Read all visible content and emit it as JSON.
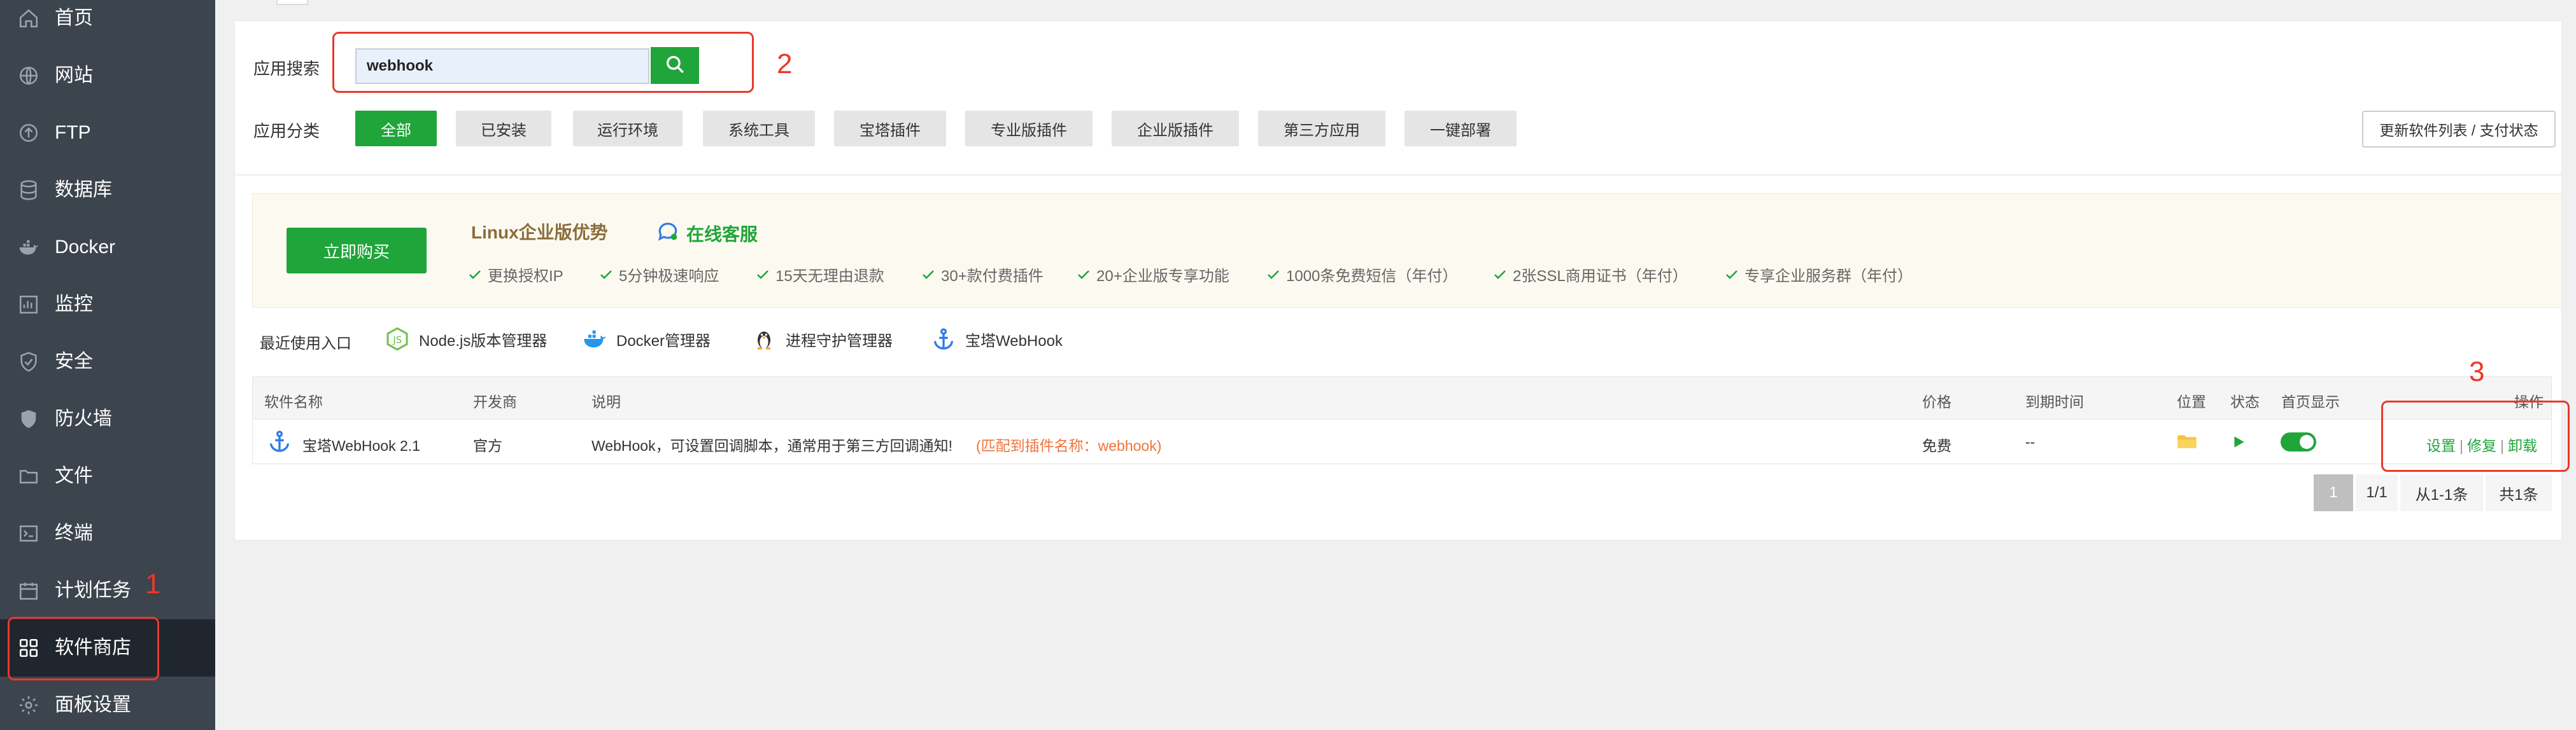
{
  "sidebar": {
    "items": [
      {
        "label": "首页",
        "icon": "home-icon"
      },
      {
        "label": "网站",
        "icon": "globe-icon"
      },
      {
        "label": "FTP",
        "icon": "ftp-icon"
      },
      {
        "label": "数据库",
        "icon": "database-icon"
      },
      {
        "label": "Docker",
        "icon": "docker-icon"
      },
      {
        "label": "监控",
        "icon": "monitor-icon"
      },
      {
        "label": "安全",
        "icon": "shield-icon"
      },
      {
        "label": "防火墙",
        "icon": "firewall-icon"
      },
      {
        "label": "文件",
        "icon": "folder-icon"
      },
      {
        "label": "终端",
        "icon": "terminal-icon"
      },
      {
        "label": "计划任务",
        "icon": "calendar-icon"
      },
      {
        "label": "软件商店",
        "icon": "apps-grid-icon",
        "active": true
      },
      {
        "label": "面板设置",
        "icon": "gear-icon"
      }
    ]
  },
  "search": {
    "label": "应用搜索",
    "value": "webhook"
  },
  "categories": {
    "label": "应用分类",
    "items": [
      "全部",
      "已安装",
      "运行环境",
      "系统工具",
      "宝塔插件",
      "专业版插件",
      "企业版插件",
      "第三方应用",
      "一键部署"
    ],
    "active": "全部",
    "update_button": "更新软件列表 / 支付状态"
  },
  "banner": {
    "buy_button": "立即购买",
    "title": "Linux企业版优势",
    "service_link": "在线客服",
    "features": [
      "更换授权IP",
      "5分钟极速响应",
      "15天无理由退款",
      "30+款付费插件",
      "20+企业版专享功能",
      "1000条免费短信（年付）",
      "2张SSL商用证书（年付）",
      "专享企业服务群（年付）"
    ]
  },
  "recent": {
    "label": "最近使用入口",
    "items": [
      {
        "label": "Node.js版本管理器",
        "icon": "nodejs-icon"
      },
      {
        "label": "Docker管理器",
        "icon": "docker-icon"
      },
      {
        "label": "进程守护管理器",
        "icon": "penguin-icon"
      },
      {
        "label": "宝塔WebHook",
        "icon": "anchor-icon"
      }
    ]
  },
  "table": {
    "headers": {
      "name": "软件名称",
      "developer": "开发商",
      "description": "说明",
      "price": "价格",
      "expire": "到期时间",
      "location": "位置",
      "status": "状态",
      "homepage": "首页显示",
      "actions": "操作"
    },
    "rows": [
      {
        "name": "宝塔WebHook 2.1",
        "developer": "官方",
        "description": "WebHook，可设置回调脚本，通常用于第三方回调通知!",
        "match_note": "(匹配到插件名称：webhook)",
        "price": "免费",
        "expire": "--",
        "homepage_on": true,
        "actions": {
          "settings": "设置",
          "repair": "修复",
          "uninstall": "卸载",
          "sep": "|"
        }
      }
    ]
  },
  "pager": {
    "current": "1",
    "pages": "1/1",
    "range": "从1-1条",
    "total": "共1条"
  },
  "annotations": {
    "n1": "1",
    "n2": "2",
    "n3": "3",
    "color": "#e8392c"
  },
  "colors": {
    "sidebar_bg": "#3c444d",
    "sidebar_active": "#1f262e",
    "accent_green": "#20a53a",
    "orange_note": "#f0743a",
    "banner_title": "#8a6d3b"
  }
}
